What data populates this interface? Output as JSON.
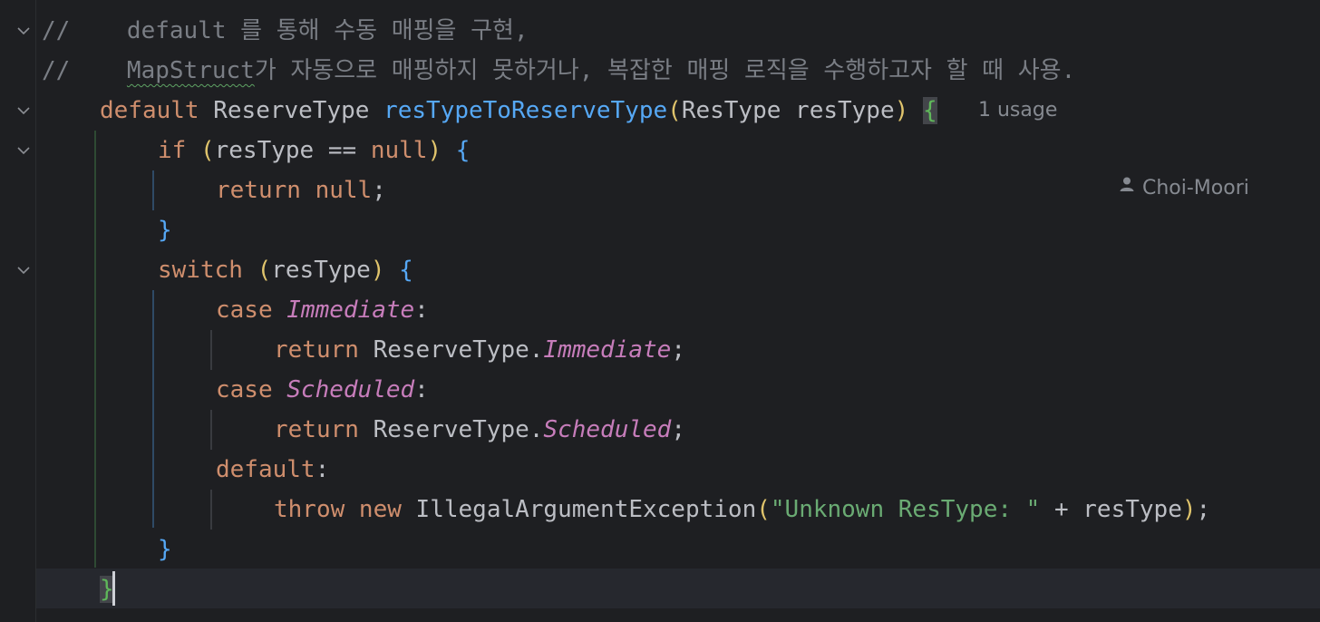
{
  "editor": {
    "lines": [
      {
        "indent": 0,
        "tokens": [
          {
            "t": "//    default 를 통해 수동 매핑을 구현,",
            "c": "cmt"
          }
        ]
      },
      {
        "indent": 0,
        "tokens": [
          {
            "t": "//    ",
            "c": "cmt"
          },
          {
            "t": "MapStruct",
            "c": "cmt squiggle"
          },
          {
            "t": "가 자동으로 매핑하지 못하거나, 복잡한 매핑 로직을 수행하고자 할 때 사용.",
            "c": "cmt"
          }
        ]
      },
      {
        "indent": 1,
        "tokens": [
          {
            "t": "default ",
            "c": "kw"
          },
          {
            "t": "ReserveType ",
            "c": "typ"
          },
          {
            "t": "resTypeToReserveType",
            "c": "fn"
          },
          {
            "t": "(",
            "c": "par1"
          },
          {
            "t": "ResType resType",
            "c": "typ"
          },
          {
            "t": ") ",
            "c": "par1"
          },
          {
            "t": "{",
            "c": "brace-hl"
          }
        ]
      },
      {
        "indent": 2,
        "tokens": [
          {
            "t": "if ",
            "c": "kw"
          },
          {
            "t": "(",
            "c": "par1"
          },
          {
            "t": "resType == ",
            "c": "typ"
          },
          {
            "t": "null",
            "c": "kw"
          },
          {
            "t": ") ",
            "c": "par1"
          },
          {
            "t": "{",
            "c": "par2"
          }
        ]
      },
      {
        "indent": 3,
        "tokens": [
          {
            "t": "return ",
            "c": "kw"
          },
          {
            "t": "null",
            "c": "kw"
          },
          {
            "t": ";",
            "c": "typ"
          }
        ]
      },
      {
        "indent": 2,
        "tokens": [
          {
            "t": "}",
            "c": "par2"
          }
        ]
      },
      {
        "indent": 2,
        "tokens": [
          {
            "t": "switch ",
            "c": "kw"
          },
          {
            "t": "(",
            "c": "par1"
          },
          {
            "t": "resType",
            "c": "typ"
          },
          {
            "t": ") ",
            "c": "par1"
          },
          {
            "t": "{",
            "c": "par2"
          }
        ]
      },
      {
        "indent": 3,
        "tokens": [
          {
            "t": "case ",
            "c": "kw"
          },
          {
            "t": "Immediate",
            "c": "enum"
          },
          {
            "t": ":",
            "c": "typ"
          }
        ]
      },
      {
        "indent": 4,
        "tokens": [
          {
            "t": "return ",
            "c": "kw"
          },
          {
            "t": "ReserveType.",
            "c": "typ"
          },
          {
            "t": "Immediate",
            "c": "enum"
          },
          {
            "t": ";",
            "c": "typ"
          }
        ]
      },
      {
        "indent": 3,
        "tokens": [
          {
            "t": "case ",
            "c": "kw"
          },
          {
            "t": "Scheduled",
            "c": "enum"
          },
          {
            "t": ":",
            "c": "typ"
          }
        ]
      },
      {
        "indent": 4,
        "tokens": [
          {
            "t": "return ",
            "c": "kw"
          },
          {
            "t": "ReserveType.",
            "c": "typ"
          },
          {
            "t": "Scheduled",
            "c": "enum"
          },
          {
            "t": ";",
            "c": "typ"
          }
        ]
      },
      {
        "indent": 3,
        "tokens": [
          {
            "t": "default",
            "c": "kw"
          },
          {
            "t": ":",
            "c": "typ"
          }
        ]
      },
      {
        "indent": 4,
        "tokens": [
          {
            "t": "throw ",
            "c": "kw"
          },
          {
            "t": "new ",
            "c": "kw"
          },
          {
            "t": "IllegalArgumentException",
            "c": "typ"
          },
          {
            "t": "(",
            "c": "par1"
          },
          {
            "t": "\"Unknown ResType: \"",
            "c": "str"
          },
          {
            "t": " + resType",
            "c": "typ"
          },
          {
            "t": ")",
            "c": "par1"
          },
          {
            "t": ";",
            "c": "typ"
          }
        ]
      },
      {
        "indent": 2,
        "tokens": [
          {
            "t": "}",
            "c": "par2"
          }
        ]
      },
      {
        "indent": 1,
        "tokens": [
          {
            "t": "}",
            "c": "brace-hl"
          }
        ]
      }
    ]
  },
  "inlay_hints": {
    "usages": "1 usage",
    "author": "Choi-Moori"
  },
  "icons": {
    "fold": "chevron-down-icon",
    "author": "user-icon"
  }
}
